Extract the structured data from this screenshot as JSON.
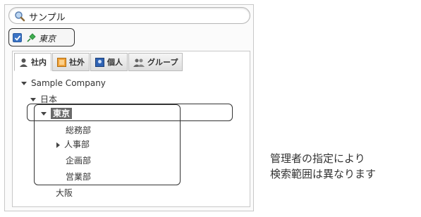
{
  "search": {
    "value": "サンプル"
  },
  "pinned": {
    "checked": true,
    "label": "東京"
  },
  "tabs": [
    {
      "label": "社内",
      "icon": "person-icon",
      "active": true
    },
    {
      "label": "社外",
      "icon": "building-icon",
      "active": false
    },
    {
      "label": "個人",
      "icon": "contact-card-icon",
      "active": false
    },
    {
      "label": "グループ",
      "icon": "group-icon",
      "active": false
    }
  ],
  "tree": {
    "company": "Sample Company",
    "japan": "日本",
    "tokyo": "東京",
    "tokyo_children": [
      "総務部",
      "人事部",
      "企画部",
      "営業部"
    ],
    "osaka": "大阪"
  },
  "note": {
    "line1": "管理者の指定により",
    "line2": "検索範囲は異なります"
  },
  "colors": {
    "accent": "#3b73c4",
    "selected_bg": "#6a6a6a"
  }
}
